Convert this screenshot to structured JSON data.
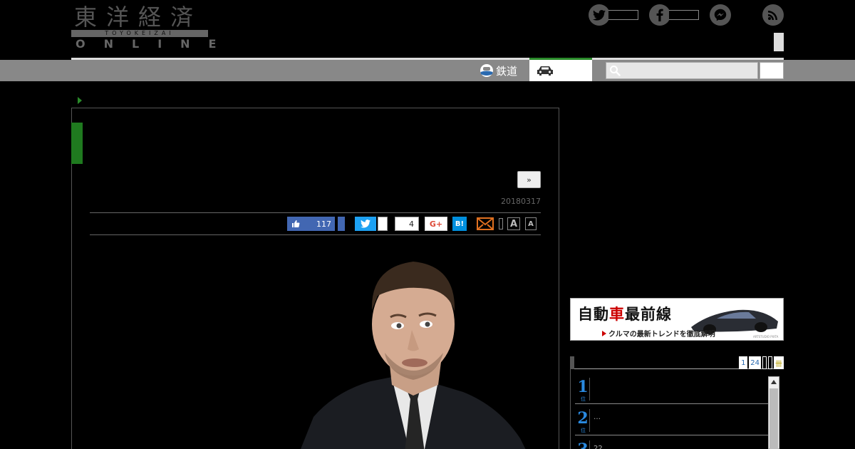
{
  "logo": {
    "kanji": "東洋経済",
    "sub": "TOYOKEIZAI",
    "online": "ONLINE"
  },
  "social": {
    "twitter_icon": "twitter-icon",
    "facebook_icon": "facebook-icon",
    "messenger_icon": "messenger-icon",
    "rss_icon": "rss-icon"
  },
  "nav": {
    "rail_label": "鉄道",
    "search_placeholder": ""
  },
  "article": {
    "next_label": "»",
    "date": "20180317"
  },
  "share": {
    "fb_count": "117",
    "pocket_count": "4",
    "gplus_label": "G+",
    "hatena_label": "B!",
    "font_large": "A",
    "font_small": "A"
  },
  "banner": {
    "title_part1": "自動",
    "title_red": "車",
    "title_part2": "最前線",
    "subtitle": "クルマの最新トレンドを徹底解明",
    "credit": "ARTSTUDIO PIXTA"
  },
  "ranking": {
    "tabs": [
      "1",
      "24",
      "",
      "",
      "卌"
    ],
    "unit": "位",
    "items": [
      {
        "num": "1",
        "text": ""
      },
      {
        "num": "2",
        "text": "…"
      },
      {
        "num": "3",
        "text": "22"
      }
    ]
  },
  "colors": {
    "accent_green": "#2a8a2a",
    "nav_gray": "#888888",
    "facebook_blue": "#4267b2",
    "twitter_blue": "#1da1f2",
    "rank_blue": "#2a8ae0"
  }
}
